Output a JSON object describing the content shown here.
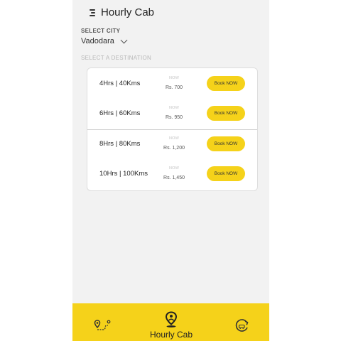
{
  "header": {
    "title": "Hourly Cab",
    "menu_icon": "menu-icon"
  },
  "city": {
    "label": "SELECT CITY",
    "value": "Vadodara"
  },
  "destination": {
    "label": "SELECT A DESTINATION"
  },
  "packages": [
    {
      "name": "4Hrs | 40Kms",
      "now_label": "NOW",
      "price": "Rs. 700",
      "button": "Book NOW"
    },
    {
      "name": "6Hrs | 60Kms",
      "now_label": "NOW",
      "price": "Rs. 950",
      "button": "Book NOW"
    },
    {
      "name": "8Hrs | 80Kms",
      "now_label": "NOW",
      "price": "Rs. 1,200",
      "button": "Book NOW"
    },
    {
      "name": "10Hrs | 100Kms",
      "now_label": "NOW",
      "price": "Rs. 1,450",
      "button": "Book NOW"
    }
  ],
  "bottom_nav": {
    "active_label": "Hourly Cab",
    "items": [
      "route-icon",
      "location-person-icon",
      "round-trip-icon"
    ]
  },
  "colors": {
    "accent": "#f5d21a",
    "background": "#f2f2f2",
    "card": "#ffffff"
  }
}
